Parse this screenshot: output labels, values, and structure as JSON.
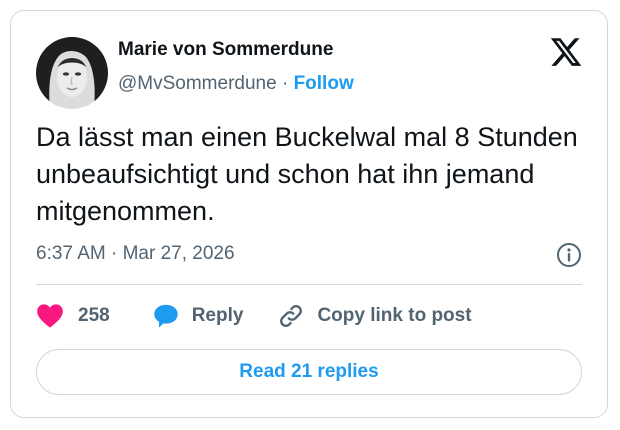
{
  "author": {
    "name": "Marie von Sommerdune",
    "handle": "@MvSommerdune",
    "separator": "·",
    "follow_label": "Follow",
    "avatar_icon": "portrait-avatar"
  },
  "tweet": {
    "text": "Da lässt man einen Buckelwal mal 8 Stunden unbeaufsichtigt und schon hat ihn jemand mitgenommen.",
    "timestamp": "6:37 AM · Mar 27, 2026"
  },
  "actions": {
    "like_count": "258",
    "reply_label": "Reply",
    "copy_label": "Copy link to post"
  },
  "read_replies_label": "Read 21 replies",
  "icons": {
    "brand": "x-logo",
    "info": "info-icon",
    "like": "heart-icon",
    "reply": "speech-bubble-icon",
    "copy": "link-icon"
  },
  "colors": {
    "accent": "#1d9bf0",
    "like": "#f91880",
    "text": "#0f1419",
    "muted": "#536471",
    "border": "#cfd9de"
  }
}
